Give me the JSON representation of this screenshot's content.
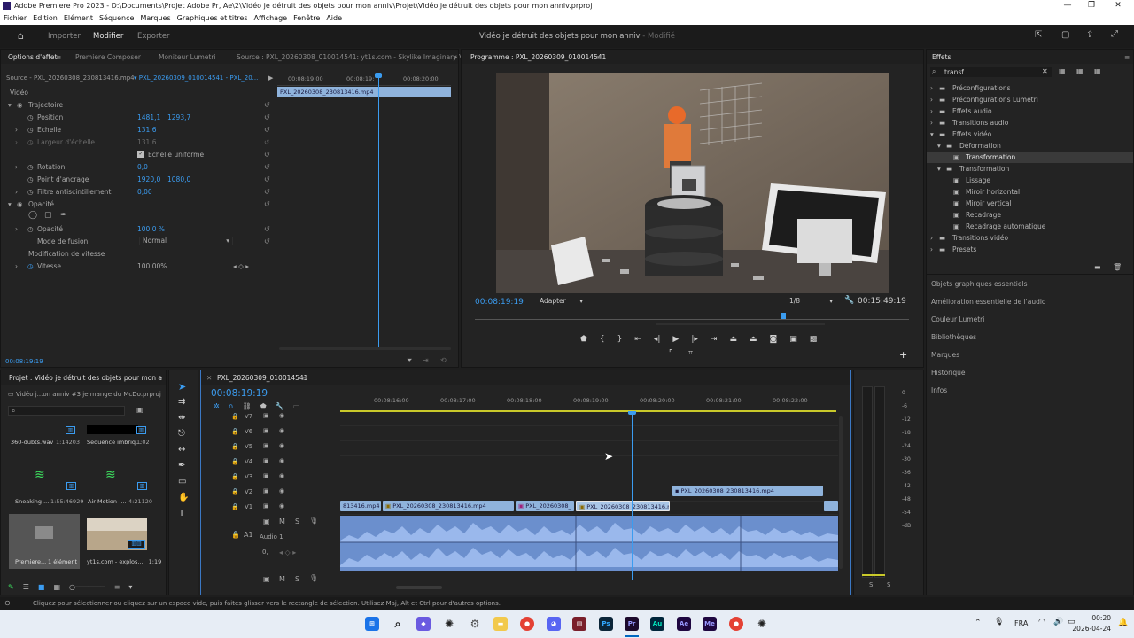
{
  "window": {
    "title": "Adobe Premiere Pro 2023 - D:\\Documents\\Projet Adobe Pr, Ae\\2\\Vidéo je détruit des objets pour mon anniv\\Projet\\Vidéo je détruit des objets pour mon anniv.prproj"
  },
  "menu": [
    "Fichier",
    "Edition",
    "Elément",
    "Séquence",
    "Marques",
    "Graphiques et titres",
    "Affichage",
    "Fenêtre",
    "Aide"
  ],
  "workspace": {
    "tabs": [
      "Importer",
      "Modifier",
      "Exporter"
    ],
    "active": "Modifier",
    "project_title": "Vidéo je détruit des objets pour mon anniv",
    "modified": "- Modifié"
  },
  "effect_controls": {
    "tabs": [
      "Options d'effet",
      "Premiere Composer",
      "Moniteur Lumetri",
      "Source : PXL_20260308_010014541: yt1s.com - Skylike  Imaginary Vi"
    ],
    "source_clip": "Source - PXL_20260308_230813416.mp4",
    "seq_clip": "PXL_20260309_010014541 - PXL_20...",
    "mini_clip": "PXL_20260308_230813416.mp4",
    "ruler": [
      "00:08:19:00",
      "00:08:19:",
      "00:08:20:00"
    ],
    "section_video": "Vidéo",
    "rows": {
      "trajectoire": "Trajectoire",
      "position": "Position",
      "position_x": "1481,1",
      "position_y": "1293,7",
      "echelle": "Echelle",
      "echelle_val": "131,6",
      "largeur": "Largeur d'échelle",
      "largeur_val": "131,6",
      "echelle_uniforme": "Echelle uniforme",
      "rotation": "Rotation",
      "rotation_val": "0,0",
      "ancrage": "Point d'ancrage",
      "ancrage_x": "1920,0",
      "ancrage_y": "1080,0",
      "filtre": "Filtre antiscintillement",
      "filtre_val": "0,00",
      "opacite": "Opacité",
      "opacite_row": "Opacité",
      "opacite_val": "100,0 %",
      "fusion": "Mode de fusion",
      "fusion_val": "Normal",
      "vitesse_sec": "Modification de vitesse",
      "vitesse": "Vitesse",
      "vitesse_val": "100,00%"
    },
    "timecode": "00:08:19:19"
  },
  "program": {
    "title": "Programme : PXL_20260309_010014541",
    "timecode": "00:08:19:19",
    "fit": "Adapter",
    "resolution": "1/8",
    "duration": "00:15:49:19"
  },
  "project": {
    "tab": "Projet : Vidéo je détruit des objets pour mon a",
    "bin_path": "Vidéo j...on anniv #3 je mange du McDo.prproj",
    "items": [
      {
        "name": "360-dubts.wav",
        "dur": "1:14203"
      },
      {
        "name": "Séquence imbriq...",
        "dur": "1:02"
      },
      {
        "name": "Sneaking ...",
        "dur": "1:55:46929"
      },
      {
        "name": "Air Motion -...",
        "dur": "4:21120"
      },
      {
        "name": "Premiere...",
        "dur": "1 élément"
      },
      {
        "name": "yt1s.com - explos...",
        "dur": "1:19"
      }
    ]
  },
  "timeline": {
    "tab": "PXL_20260309_010014541",
    "timecode": "00:08:19:19",
    "ruler": [
      "00:08:16:00",
      "00:08:17:00",
      "00:08:18:00",
      "00:08:19:00",
      "00:08:20:00",
      "00:08:21:00",
      "00:08:22:00"
    ],
    "tracks": [
      "V7",
      "V6",
      "V5",
      "V4",
      "V3",
      "V2",
      "V1"
    ],
    "audio_track": "A1",
    "audio_name": "Audio 1",
    "audio_level": "0,",
    "clips": {
      "v2": "PXL_20260308_230813416.mp4",
      "v1a": "813416.mp4 [V]",
      "v1b": "PXL_20260308_230813416.mp4",
      "v1c": "PXL_20260308_",
      "v1d": "PXL_20260308_230813416.mp"
    }
  },
  "effects_panel": {
    "title": "Effets",
    "search": "transf",
    "tree": [
      "Préconfigurations",
      "Préconfigurations Lumetri",
      "Effets audio",
      "Transitions audio",
      "Effets vidéo",
      "Déformation",
      "Transformation",
      "Transformation",
      "Lissage",
      "Miroir horizontal",
      "Miroir vertical",
      "Recadrage",
      "Recadrage automatique",
      "Transitions vidéo",
      "Presets"
    ],
    "sections": [
      "Objets graphiques essentiels",
      "Amélioration essentielle de l'audio",
      "Couleur Lumetri",
      "Bibliothèques",
      "Marques",
      "Historique",
      "Infos"
    ]
  },
  "meter_scale": [
    "0",
    "-6",
    "-12",
    "-18",
    "-24",
    "-30",
    "-36",
    "-42",
    "-48",
    "-54",
    "-dB"
  ],
  "meter_solo": [
    "S",
    "S"
  ],
  "status": "Cliquez pour sélectionner ou cliquez sur un espace vide, puis faites glisser vers le rectangle de sélection. Utilisez Maj, Alt et Ctrl pour d'autres options.",
  "taskbar": {
    "apps": [
      "Ps",
      "Pr",
      "Au",
      "Ae",
      "Me"
    ],
    "lang": "FRA",
    "time": "00:20",
    "date": "2026-04-24"
  },
  "colors": {
    "accent": "#3b9cf0",
    "clip_video": "#8fb3dc",
    "clip_audio": "#7f9fd6",
    "playhead": "#3b9cf0"
  }
}
